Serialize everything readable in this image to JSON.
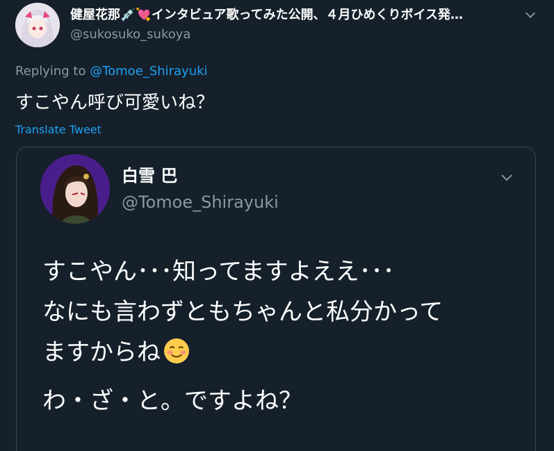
{
  "author": {
    "display_name": "健屋花那💉💘インタビュア歌ってみた公開、４月ひめくりボイス発…",
    "handle": "@sukosuko_sukoya",
    "avatar_icon": "anime-avatar-white-hair"
  },
  "reply": {
    "prefix": "Replying to ",
    "mention": "@Tomoe_Shirayuki"
  },
  "tweet": {
    "text": "すこやん呼び可愛いね？",
    "translate_label": "Translate Tweet"
  },
  "quoted": {
    "display_name": "白雪 巴",
    "handle": "@Tomoe_Shirayuki",
    "avatar_icon": "anime-avatar-dark-hair",
    "lines": [
      "すこやん･･･知ってますよええ･･･",
      "なにも言わずともちゃんと私分かって",
      "ますからね",
      "わ・ざ・と。ですよね？"
    ],
    "emoji_icon": "smiling-face-emoji"
  },
  "colors": {
    "background": "#15202b",
    "accent": "#1da1f2",
    "muted": "#8899a6",
    "border": "#38444d"
  }
}
